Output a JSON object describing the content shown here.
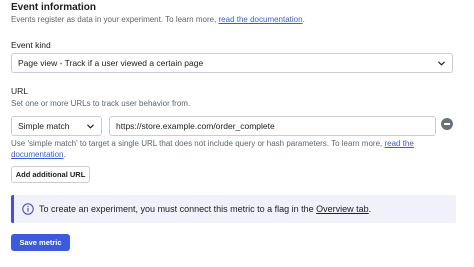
{
  "event_info": {
    "title": "Event information",
    "description_prefix": "Events register as data in your experiment. To learn more, ",
    "description_link": "read the documentation",
    "description_suffix": "."
  },
  "event_kind": {
    "label": "Event kind",
    "selected": "Page view - Track if a user viewed a certain page"
  },
  "url": {
    "label": "URL",
    "description": "Set one or more URLs to track user behavior from.",
    "match_type": "Simple match",
    "value": "https://store.example.com/order_complete",
    "help_line1": "Use 'simple match' to target a single URL that does not include query or hash parameters. To learn more, ",
    "help_link_line1": "read the",
    "help_link_line2": "documentation",
    "help_suffix": ".",
    "add_button": "Add additional URL"
  },
  "callout": {
    "prefix": "To create an experiment, you must connect this metric to a flag in the ",
    "link": "Overview tab",
    "suffix": "."
  },
  "save_button": "Save metric",
  "colors": {
    "primary": "#3b5bdb",
    "callout_bg": "#f1f1fb",
    "callout_border": "#4b4fc6"
  }
}
